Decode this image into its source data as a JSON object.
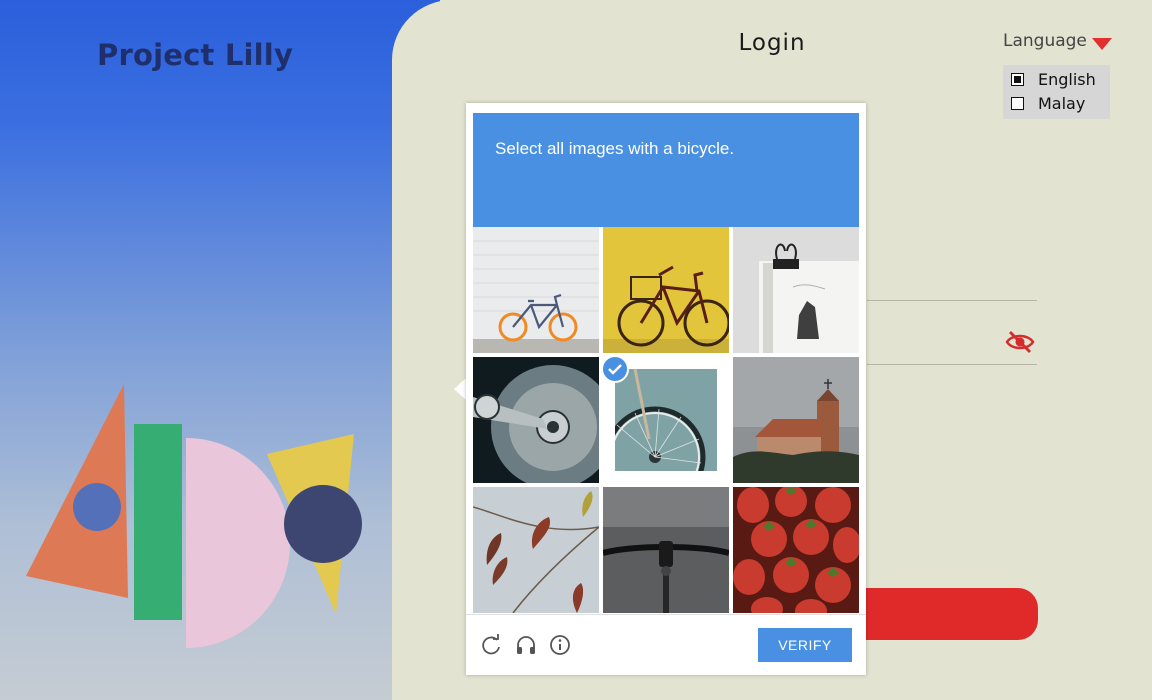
{
  "brand": {
    "name": "Project Lilly"
  },
  "login": {
    "title": "Login"
  },
  "language": {
    "label": "Language",
    "options": [
      {
        "label": "English",
        "selected": true
      },
      {
        "label": "Malay",
        "selected": false
      }
    ]
  },
  "captcha": {
    "prompt": "Select all images with a bicycle.",
    "verify_label": "VERIFY",
    "accent_color": "#4a90e2",
    "tiles": [
      {
        "subject": "bicycle against white brick wall",
        "selected": false
      },
      {
        "subject": "bicycle with basket against yellow wall",
        "selected": false
      },
      {
        "subject": "book with binder clip",
        "selected": false
      },
      {
        "subject": "hard disk drive",
        "selected": false
      },
      {
        "subject": "bicycle wheel",
        "selected": true
      },
      {
        "subject": "church under grey sky",
        "selected": false
      },
      {
        "subject": "autumn leaves on branch",
        "selected": false
      },
      {
        "subject": "bicycle handlebar",
        "selected": false
      },
      {
        "subject": "strawberries",
        "selected": false
      }
    ],
    "footer_icons": [
      "reload-icon",
      "audio-headphones-icon",
      "info-icon"
    ]
  },
  "colors": {
    "primary_red": "#e02a2a",
    "left_panel_blue": "#2b5fdc"
  }
}
